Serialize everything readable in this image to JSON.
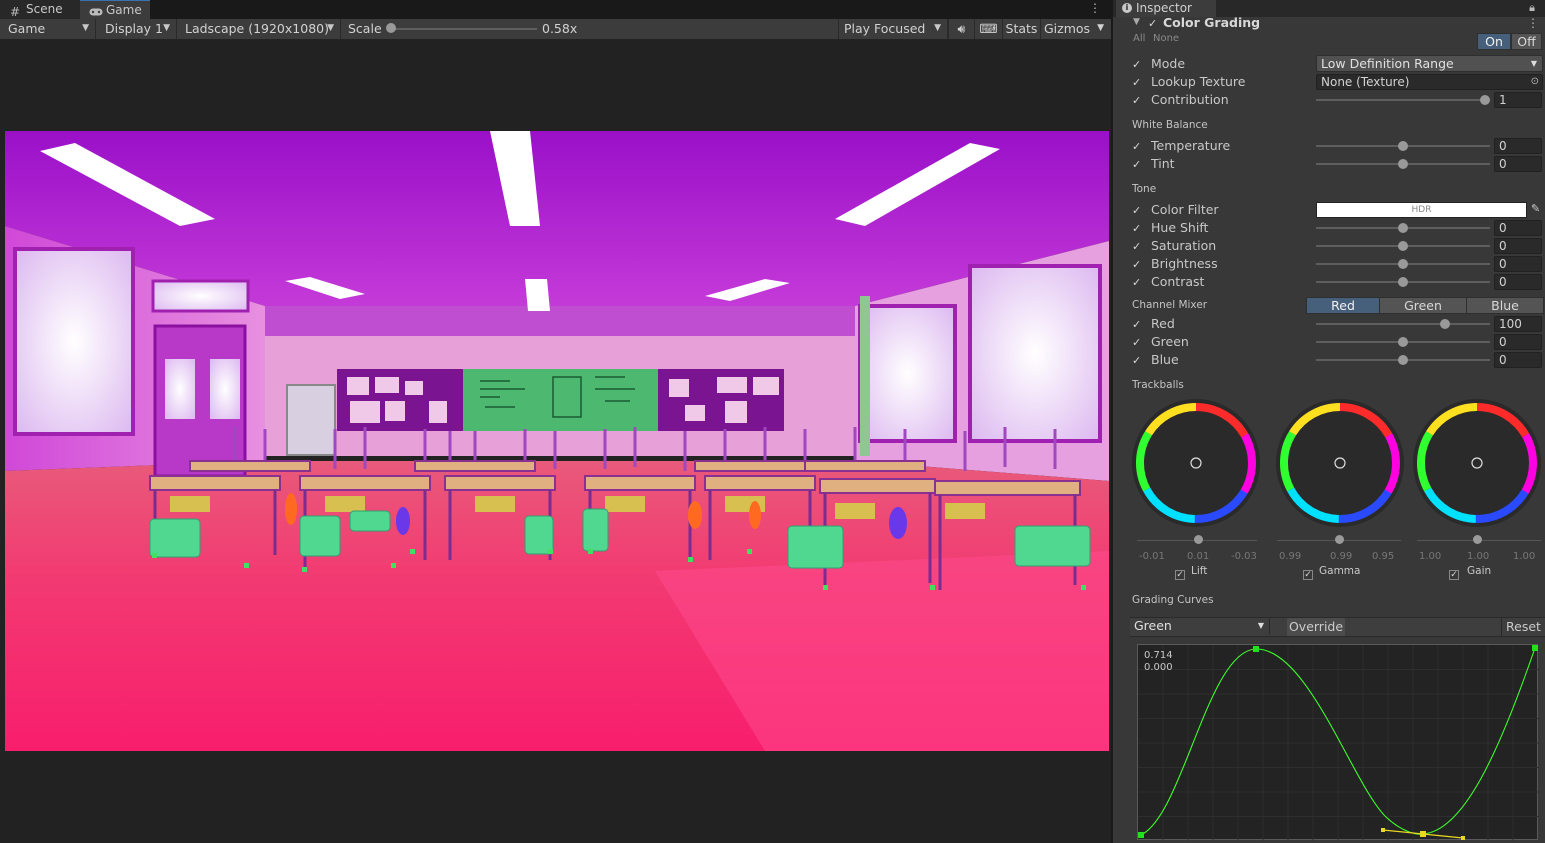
{
  "tabs": [
    {
      "label": "Scene",
      "icon": "grid-icon"
    },
    {
      "label": "Game",
      "icon": "gamepad-icon"
    }
  ],
  "game_toolbar": {
    "view": "Game",
    "display": "Display 1",
    "resolution": "Ladscape (1920x1080)",
    "scale_label": "Scale",
    "scale_value": "0.58x",
    "scale_fraction": 0.0,
    "play_mode": "Play Focused",
    "stats": "Stats",
    "gizmos": "Gizmos"
  },
  "inspector": {
    "tab_label": "Inspector",
    "component": "Color Grading",
    "all_label": "All",
    "none_label": "None",
    "on_label": "On",
    "off_label": "Off",
    "mode_label": "Mode",
    "mode_value": "Low Definition Range",
    "lookup_label": "Lookup Texture",
    "lookup_value": "None (Texture)",
    "contribution_label": "Contribution",
    "contribution_value": "1",
    "white_balance": {
      "title": "White Balance",
      "temperature_label": "Temperature",
      "temperature_value": "0",
      "tint_label": "Tint",
      "tint_value": "0"
    },
    "tone": {
      "title": "Tone",
      "color_filter_label": "Color Filter",
      "color_filter_value": "HDR",
      "hue_label": "Hue Shift",
      "hue_value": "0",
      "sat_label": "Saturation",
      "sat_value": "0",
      "bright_label": "Brightness",
      "bright_value": "0",
      "contrast_label": "Contrast",
      "contrast_value": "0"
    },
    "channel_mixer": {
      "title": "Channel Mixer",
      "tabs": [
        "Red",
        "Green",
        "Blue"
      ],
      "red_label": "Red",
      "red_value": "100",
      "green_label": "Green",
      "green_value": "0",
      "blue_label": "Blue",
      "blue_value": "0"
    },
    "trackballs": {
      "title": "Trackballs",
      "lift": {
        "label": "Lift",
        "values": [
          "-0.01",
          "0.01",
          "-0.03"
        ]
      },
      "gamma": {
        "label": "Gamma",
        "values": [
          "0.99",
          "0.99",
          "0.95"
        ]
      },
      "gain": {
        "label": "Gain",
        "values": [
          "1.00",
          "1.00",
          "1.00"
        ]
      }
    },
    "curves": {
      "title": "Grading Curves",
      "channel": "Green",
      "override_label": "Override",
      "reset_label": "Reset",
      "readout_value": "0.714",
      "readout_time": "0.000"
    }
  },
  "colors": {
    "accent_blue": "#46607c",
    "curve_green": "#3cff28",
    "tangent_yellow": "#e8d820"
  }
}
